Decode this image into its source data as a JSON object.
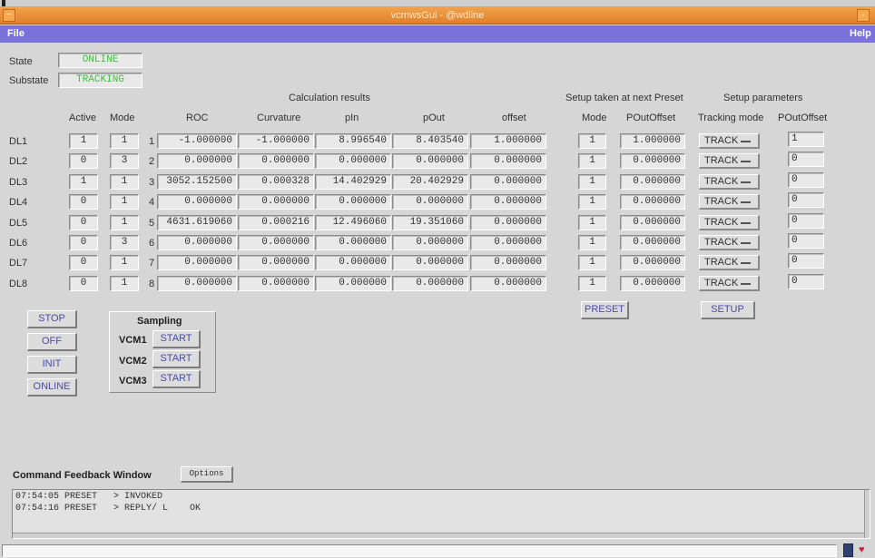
{
  "window": {
    "title": "vcmwsGui - @wdline"
  },
  "menu": {
    "file": "File",
    "help": "Help"
  },
  "status": {
    "state_label": "State",
    "state_value": "ONLINE",
    "substate_label": "Substate",
    "substate_value": "TRACKING"
  },
  "headers": {
    "calc_results": "Calculation results",
    "setup_next": "Setup taken at next Preset",
    "setup_params": "Setup parameters",
    "columns": [
      "Active",
      "Mode",
      "ROC",
      "Curvature",
      "pIn",
      "pOut",
      "offset",
      "Mode",
      "POutOffset",
      "Tracking mode",
      "POutOffset"
    ]
  },
  "rows": [
    {
      "name": "DL1",
      "active": "1",
      "mode": "1",
      "idx": "1",
      "roc": "-1.000000",
      "curv": "-1.000000",
      "pin": "8.996540",
      "pout": "8.403540",
      "offset": "1.000000",
      "next_mode": "1",
      "next_poff": "1.000000",
      "track": "TRACK",
      "poff": "1"
    },
    {
      "name": "DL2",
      "active": "0",
      "mode": "3",
      "idx": "2",
      "roc": "0.000000",
      "curv": "0.000000",
      "pin": "0.000000",
      "pout": "0.000000",
      "offset": "0.000000",
      "next_mode": "1",
      "next_poff": "0.000000",
      "track": "TRACK",
      "poff": "0"
    },
    {
      "name": "DL3",
      "active": "1",
      "mode": "1",
      "idx": "3",
      "roc": "3052.152500",
      "curv": "0.000328",
      "pin": "14.402929",
      "pout": "20.402929",
      "offset": "0.000000",
      "next_mode": "1",
      "next_poff": "0.000000",
      "track": "TRACK",
      "poff": "0"
    },
    {
      "name": "DL4",
      "active": "0",
      "mode": "1",
      "idx": "4",
      "roc": "0.000000",
      "curv": "0.000000",
      "pin": "0.000000",
      "pout": "0.000000",
      "offset": "0.000000",
      "next_mode": "1",
      "next_poff": "0.000000",
      "track": "TRACK",
      "poff": "0"
    },
    {
      "name": "DL5",
      "active": "0",
      "mode": "1",
      "idx": "5",
      "roc": "4631.619060",
      "curv": "0.000216",
      "pin": "12.496060",
      "pout": "19.351060",
      "offset": "0.000000",
      "next_mode": "1",
      "next_poff": "0.000000",
      "track": "TRACK",
      "poff": "0"
    },
    {
      "name": "DL6",
      "active": "0",
      "mode": "3",
      "idx": "6",
      "roc": "0.000000",
      "curv": "0.000000",
      "pin": "0.000000",
      "pout": "0.000000",
      "offset": "0.000000",
      "next_mode": "1",
      "next_poff": "0.000000",
      "track": "TRACK",
      "poff": "0"
    },
    {
      "name": "DL7",
      "active": "0",
      "mode": "1",
      "idx": "7",
      "roc": "0.000000",
      "curv": "0.000000",
      "pin": "0.000000",
      "pout": "0.000000",
      "offset": "0.000000",
      "next_mode": "1",
      "next_poff": "0.000000",
      "track": "TRACK",
      "poff": "0"
    },
    {
      "name": "DL8",
      "active": "0",
      "mode": "1",
      "idx": "8",
      "roc": "0.000000",
      "curv": "0.000000",
      "pin": "0.000000",
      "pout": "0.000000",
      "offset": "0.000000",
      "next_mode": "1",
      "next_poff": "0.000000",
      "track": "TRACK",
      "poff": "0"
    }
  ],
  "buttons": {
    "preset": "PRESET",
    "setup": "SETUP",
    "stop": "STOP",
    "off": "OFF",
    "init": "INIT",
    "online": "ONLINE"
  },
  "sampling": {
    "title": "Sampling",
    "items": [
      {
        "label": "VCM1",
        "button": "START"
      },
      {
        "label": "VCM2",
        "button": "START"
      },
      {
        "label": "VCM3",
        "button": "START"
      }
    ]
  },
  "feedback": {
    "title": "Command Feedback Window",
    "options": "Options",
    "lines": [
      "07:54:05 PRESET   > INVOKED",
      "07:54:16 PRESET   > REPLY/ L    OK"
    ]
  },
  "colors": {
    "menubar": "#7a72d8",
    "titlebar": "#e58a30",
    "status_text": "#3fbf3f",
    "button_text": "#4a4aa8"
  }
}
